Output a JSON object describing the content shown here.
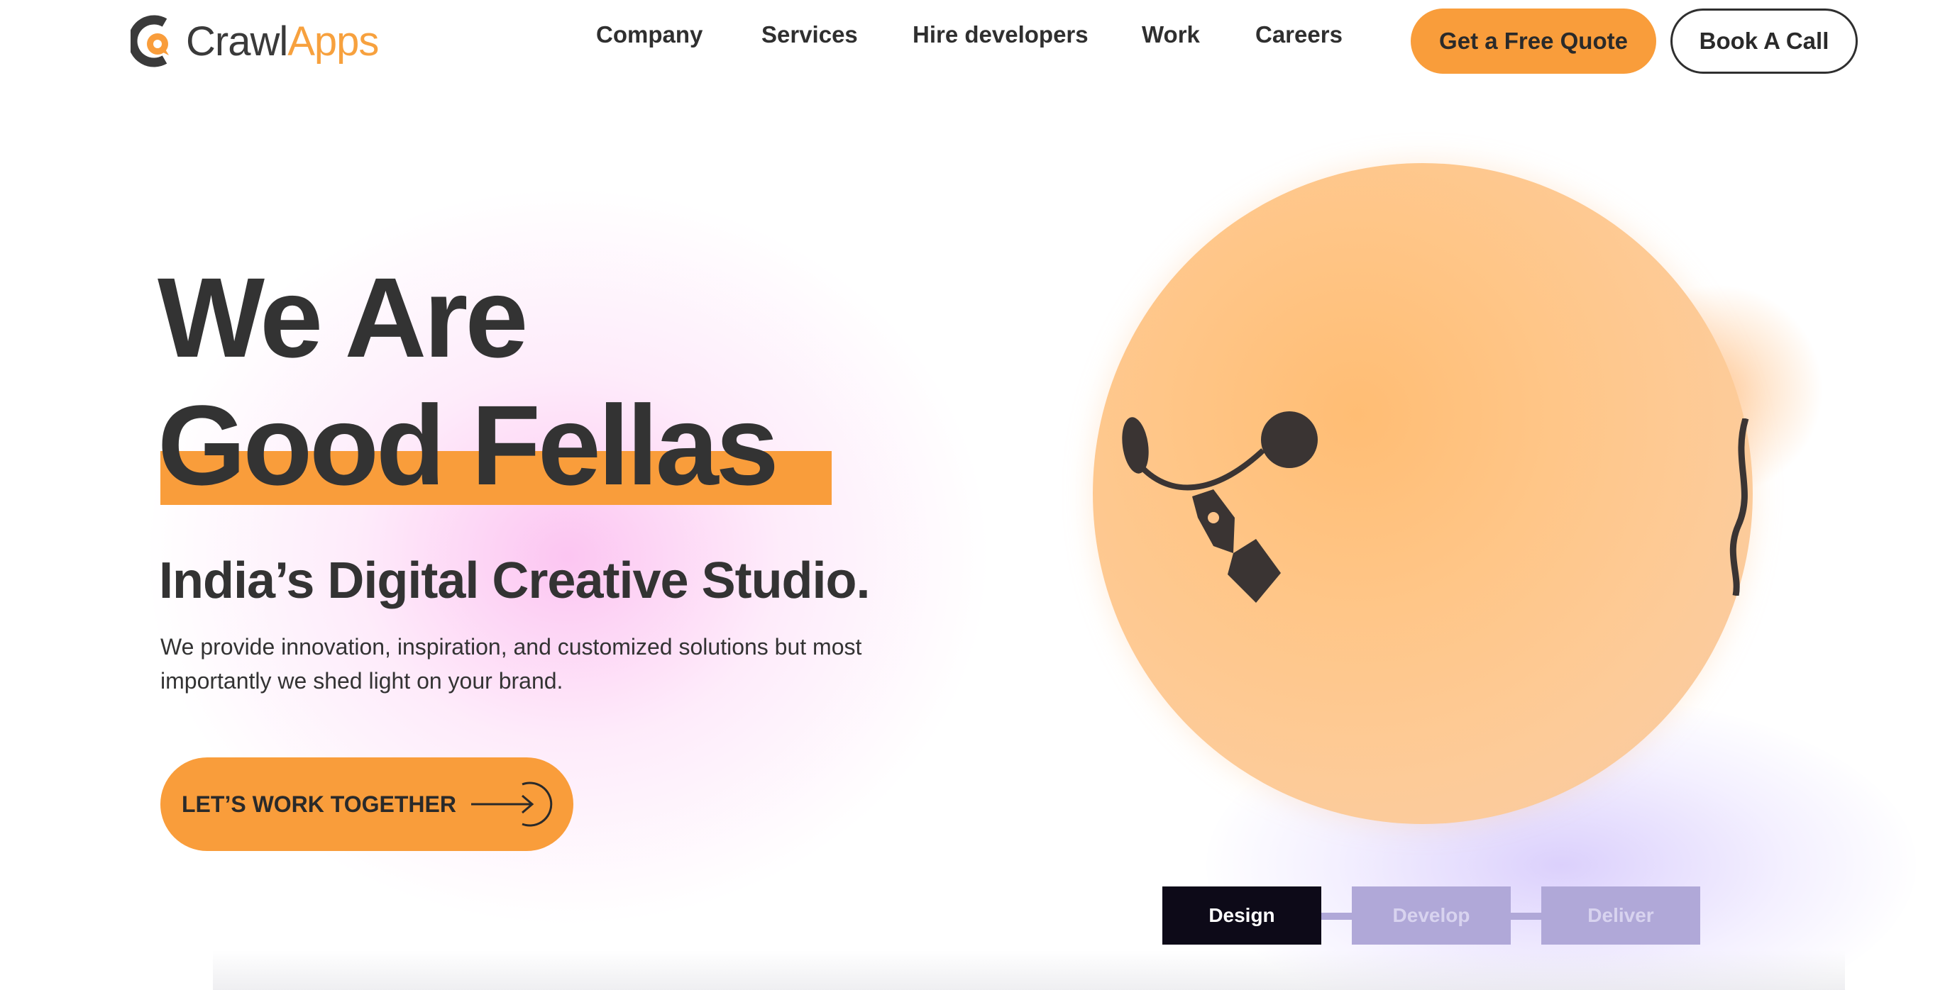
{
  "brand": {
    "name_part1": "Crawl",
    "name_part2": "Apps",
    "accent_color": "#f99d3b",
    "dark_color": "#333333"
  },
  "nav": {
    "items": [
      "Company",
      "Services",
      "Hire developers",
      "Work",
      "Careers"
    ]
  },
  "header_buttons": {
    "quote_label": "Get a Free Quote",
    "call_label": "Book A Call"
  },
  "hero": {
    "line1": "We Are",
    "line2": "Good Fellas",
    "subtitle": "India’s Digital Creative Studio.",
    "description": "We provide innovation, inspiration, and customized solutions but most importantly we shed light on your brand.",
    "cta_label": "LET’S WORK TOGETHER",
    "cta_icon": "arrow-right-circle-icon"
  },
  "illustration": {
    "icon": "pen-tool-icon"
  },
  "steps": {
    "items": [
      "Design",
      "Develop",
      "Deliver"
    ],
    "active": "Design"
  }
}
